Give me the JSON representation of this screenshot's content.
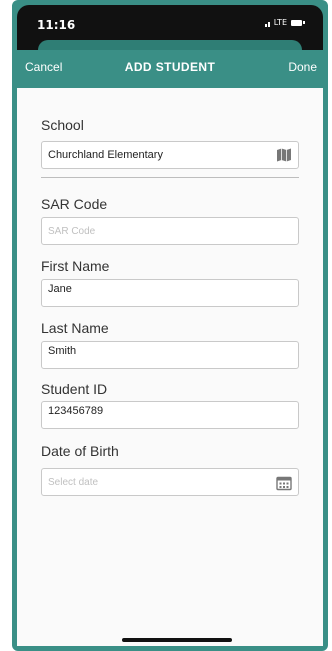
{
  "status": {
    "time": "11:16",
    "network": "LTE"
  },
  "nav": {
    "cancel": "Cancel",
    "title": "ADD STUDENT",
    "done": "Done"
  },
  "form": {
    "school": {
      "label": "School",
      "value": "Churchland Elementary",
      "icon": "map-icon"
    },
    "sar_code": {
      "label": "SAR Code",
      "placeholder": "SAR Code"
    },
    "first_name": {
      "label": "First Name",
      "value": "Jane"
    },
    "last_name": {
      "label": "Last Name",
      "value": "Smith"
    },
    "student_id": {
      "label": "Student ID",
      "value": "123456789"
    },
    "dob": {
      "label": "Date of Birth",
      "placeholder": "Select date",
      "icon": "calendar-icon"
    }
  }
}
